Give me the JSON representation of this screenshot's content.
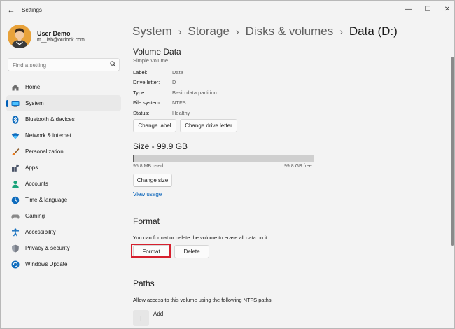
{
  "app": {
    "title": "Settings"
  },
  "window_controls": {
    "minimize": "—",
    "maximize": "☐",
    "close": "✕"
  },
  "user": {
    "name": "User Demo",
    "email": "m__lab@outlook.com"
  },
  "search": {
    "placeholder": "Find a setting"
  },
  "sidebar": {
    "items": [
      {
        "label": "Home",
        "icon": "home-icon"
      },
      {
        "label": "System",
        "icon": "system-icon",
        "active": true
      },
      {
        "label": "Bluetooth & devices",
        "icon": "bluetooth-icon"
      },
      {
        "label": "Network & internet",
        "icon": "network-icon"
      },
      {
        "label": "Personalization",
        "icon": "brush-icon"
      },
      {
        "label": "Apps",
        "icon": "apps-icon"
      },
      {
        "label": "Accounts",
        "icon": "accounts-icon"
      },
      {
        "label": "Time & language",
        "icon": "time-language-icon"
      },
      {
        "label": "Gaming",
        "icon": "gaming-icon"
      },
      {
        "label": "Accessibility",
        "icon": "accessibility-icon"
      },
      {
        "label": "Privacy & security",
        "icon": "shield-icon"
      },
      {
        "label": "Windows Update",
        "icon": "update-icon"
      }
    ]
  },
  "breadcrumb": {
    "items": [
      "System",
      "Storage",
      "Disks & volumes"
    ],
    "current": "Data (D:)"
  },
  "volume": {
    "title": "Volume Data",
    "subtitle": "Simple Volume",
    "properties": [
      {
        "label": "Label:",
        "value": "Data"
      },
      {
        "label": "Drive letter:",
        "value": "D"
      },
      {
        "label": "Type:",
        "value": "Basic data partition"
      },
      {
        "label": "File system:",
        "value": "NTFS"
      },
      {
        "label": "Status:",
        "value": "Healthy"
      }
    ],
    "change_label_button": "Change label",
    "change_drive_letter_button": "Change drive letter"
  },
  "size": {
    "title": "Size - 99.9 GB",
    "used_text": "95.8 MB used",
    "free_text": "99.8 GB free",
    "used_fraction": 0.001,
    "change_size_button": "Change size",
    "view_usage_link": "View usage"
  },
  "format": {
    "title": "Format",
    "description": "You can format or delete the volume to erase all data on it.",
    "format_button": "Format",
    "delete_button": "Delete"
  },
  "paths": {
    "title": "Paths",
    "description": "Allow access to this volume using the following NTFS paths.",
    "add_label": "Add",
    "add_symbol": "+"
  },
  "colors": {
    "accent": "#005fb8",
    "highlight": "#d6202e"
  }
}
